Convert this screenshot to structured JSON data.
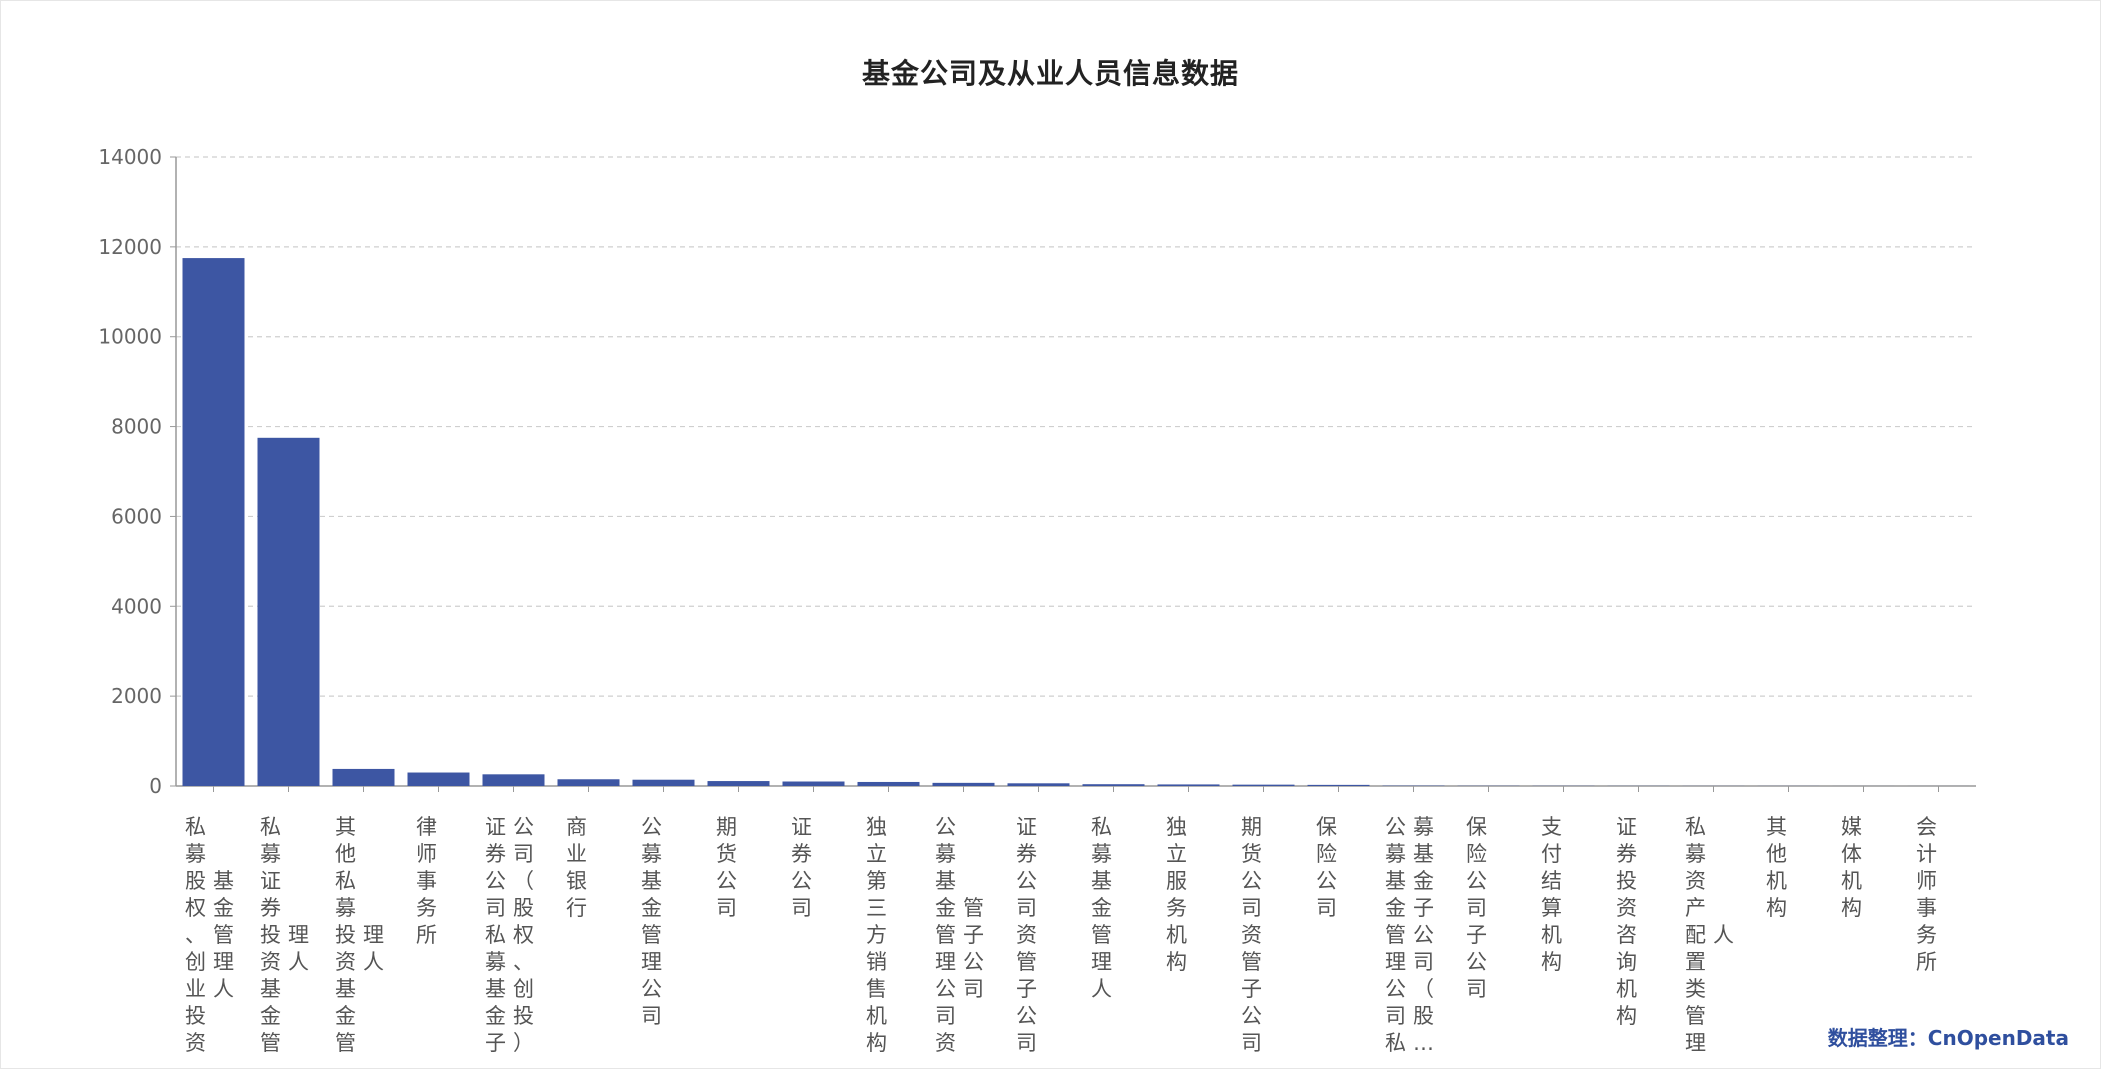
{
  "source_note": "数据整理：CnOpenData",
  "colors": {
    "bar": "#3d56a3",
    "grid": "#cfcfcf",
    "axis": "#999999"
  },
  "chart_data": {
    "type": "bar",
    "title": "基金公司及从业人员信息数据",
    "xlabel": "",
    "ylabel": "",
    "ylim": [
      0,
      14000
    ],
    "yticks": [
      0,
      2000,
      4000,
      6000,
      8000,
      10000,
      12000,
      14000
    ],
    "grid": true,
    "categories": [
      "私募股权、创业投资基金管理人",
      "私募证券投资基金管理人",
      "其他私募投资基金管理人",
      "律师事务所",
      "证券公司私募基金子公司（股权、创投）",
      "商业银行",
      "公募基金管理公司",
      "期货公司",
      "证券公司",
      "独立第三方销售机构",
      "公募基金管理公司资管子公司",
      "证券公司资管子公司",
      "私募基金管理人",
      "独立服务机构",
      "期货公司资管子公司",
      "保险公司",
      "公募基金管理公司私募基金子公司（股…",
      "保险公司子公司",
      "支付结算机构",
      "证券投资咨询机构",
      "私募资产配置类管理人",
      "其他机构",
      "媒体机构",
      "会计师事务所"
    ],
    "tick_labels": [
      [
        "私募股权、创业投资",
        "基金管理人"
      ],
      [
        "私募证券投资基金管",
        "理人"
      ],
      [
        "其他私募投资基金管",
        "理人"
      ],
      [
        "律师事务所"
      ],
      [
        "证券公司私募基金子",
        "公司（股权、创投）"
      ],
      [
        "商业银行"
      ],
      [
        "公募基金管理公司"
      ],
      [
        "期货公司"
      ],
      [
        "证券公司"
      ],
      [
        "独立第三方销售机构"
      ],
      [
        "公募基金管理公司资",
        "管子公司"
      ],
      [
        "证券公司资管子公司"
      ],
      [
        "私募基金管理人"
      ],
      [
        "独立服务机构"
      ],
      [
        "期货公司资管子公司"
      ],
      [
        "保险公司"
      ],
      [
        "公募基金管理公司私",
        "募基金子公司（股…"
      ],
      [
        "保险公司子公司"
      ],
      [
        "支付结算机构"
      ],
      [
        "证券投资咨询机构"
      ],
      [
        "私募资产配置类管理",
        "人"
      ],
      [
        "其他机构"
      ],
      [
        "媒体机构"
      ],
      [
        "会计师事务所"
      ]
    ],
    "values": [
      11750,
      7750,
      380,
      300,
      260,
      150,
      140,
      110,
      100,
      90,
      70,
      60,
      40,
      35,
      30,
      25,
      8,
      5,
      4,
      3,
      2,
      2,
      1,
      1
    ]
  }
}
